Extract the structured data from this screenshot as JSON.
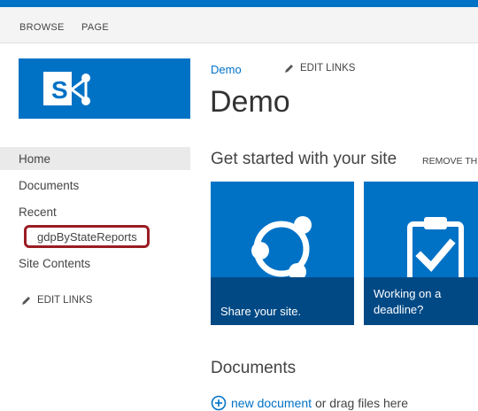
{
  "ribbon": {
    "tabs": [
      "BROWSE",
      "PAGE"
    ]
  },
  "header": {
    "breadcrumb": "Demo",
    "edit_links": "EDIT LINKS",
    "title": "Demo"
  },
  "nav": {
    "items": [
      "Home",
      "Documents",
      "Recent"
    ],
    "recent_child": "gdpByStateReports",
    "site_contents": "Site Contents",
    "edit_links": "EDIT LINKS"
  },
  "get_started": {
    "title": "Get started with your site",
    "remove": "REMOVE TH",
    "tiles": [
      {
        "caption": "Share your site.",
        "icon": "share-icon"
      },
      {
        "caption": "Working on a deadline?",
        "icon": "clipboard-check-icon"
      }
    ]
  },
  "documents": {
    "title": "Documents",
    "new_document": "new document",
    "drag_text": " or drag files here"
  },
  "colors": {
    "accent": "#0072c6",
    "highlight_border": "#9b1c24"
  }
}
